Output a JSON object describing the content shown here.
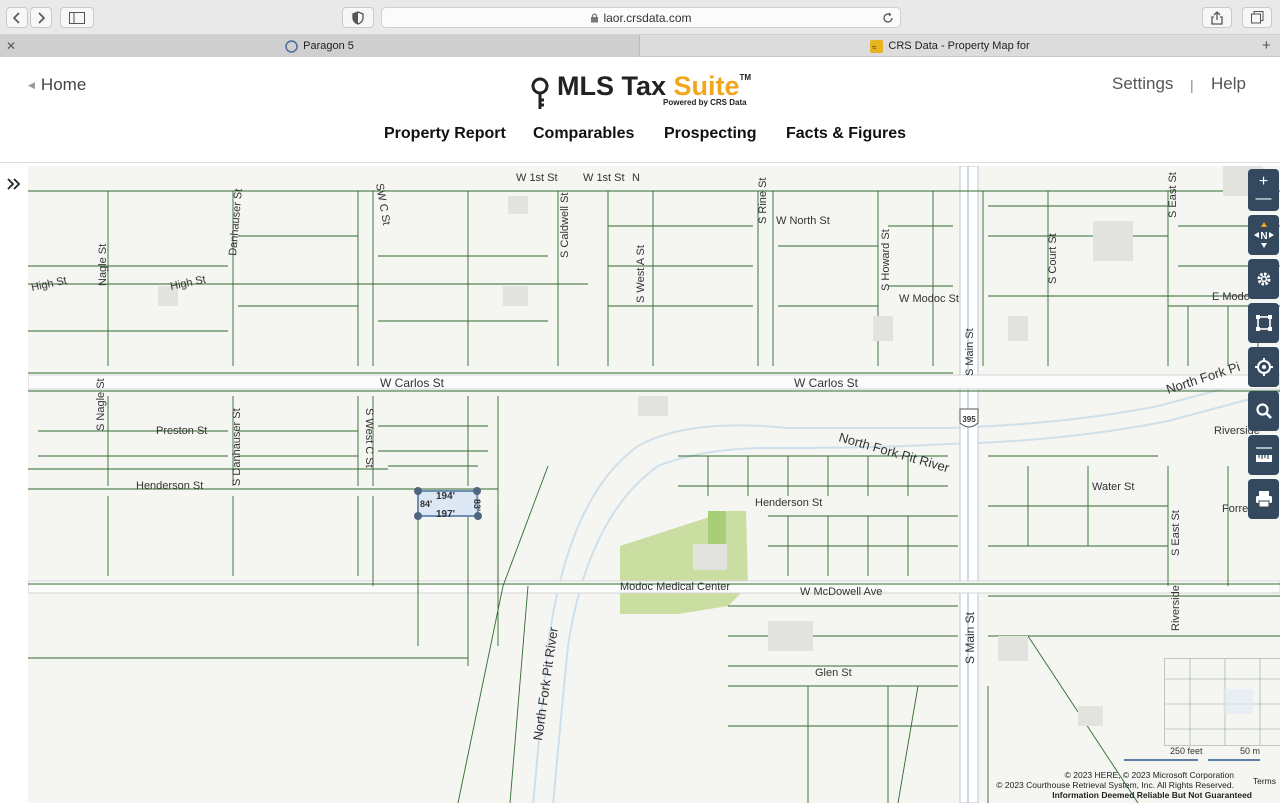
{
  "browser": {
    "url": "laor.crsdata.com",
    "tabs": [
      {
        "title": "Paragon 5",
        "active": false
      },
      {
        "title": "CRS Data - Property Map for",
        "active": true
      }
    ]
  },
  "header": {
    "home_label": "Home",
    "logo_main": "MLS Tax ",
    "logo_suite": "Suite",
    "logo_tm": "TM",
    "logo_sub": "Powered by CRS Data",
    "settings_label": "Settings",
    "separator": "|",
    "help_label": "Help",
    "nav": [
      "Property Report",
      "Comparables",
      "Prospecting",
      "Facts & Figures"
    ]
  },
  "map": {
    "streets": {
      "w1st_a": "W 1st St",
      "w1st_b": "W 1st St",
      "w1st_n": "N",
      "swc": "SW C St",
      "scaldwell": "S Caldwell St",
      "swesta": "S West A St",
      "srine": "S Rine St",
      "wnorth": "W North St",
      "showard": "S Howard St",
      "smain_top": "S Main St",
      "scourt": "S Court St",
      "seast_top": "S East St",
      "wmodoc": "W Modoc St",
      "emodoc": "E Modo",
      "high_a": "High St",
      "high_b": "High St",
      "nagle": "Nagle St",
      "danhauser": "Danhauser St",
      "wcarlos_a": "W Carlos St",
      "wcarlos_b": "W Carlos St",
      "snagle": "S Nagle St",
      "preston": "Preston St",
      "sdanhauser": "S Danhauser St",
      "swestc": "S West C St",
      "henderson_w": "Henderson St",
      "henderson_e": "Henderson St",
      "nfpr_river": "North Fork Pit River",
      "nfpr_right": "North Fork Pi",
      "riverside_top": "Riverside",
      "water": "Water St",
      "forrest": "Forrest A",
      "seast_bot": "S East St",
      "riverside_bot": "Riverside",
      "modoc_med": "Modoc Medical Center",
      "wmcdowell": "W McDowell Ave",
      "smain_bot": "S Main St",
      "glen": "Glen St",
      "nfpr_bottom": "North Fork Pit River",
      "hwy": "395"
    },
    "dimensions": {
      "top": "194'",
      "bottom": "197'",
      "left": "84'",
      "right": "83'"
    },
    "scale": {
      "feet": "250 feet",
      "meters": "50 m"
    },
    "attribution": {
      "line1": "© 2023 HERE, © 2023 Microsoft Corporation",
      "line2": "© 2023 Courthouse Retrieval System, Inc. All Rights Reserved.",
      "line3": "Information Deemed Reliable But Not Guaranteed",
      "terms": "Terms"
    },
    "controls": [
      "zoom-in",
      "zoom-out",
      "compass-north",
      "settings",
      "rectangle-select",
      "locate",
      "search",
      "measure",
      "print"
    ],
    "compass_label": "N"
  }
}
